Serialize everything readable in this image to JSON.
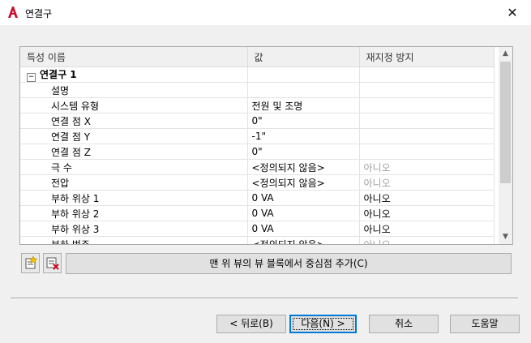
{
  "window": {
    "title": "연결구",
    "close_glyph": "✕"
  },
  "grid": {
    "columns": [
      "특성 이름",
      "값",
      "재지정 방지"
    ],
    "group": {
      "toggle": "−",
      "label": "연결구 1"
    },
    "rows": [
      {
        "name": "설명",
        "value": "",
        "no_override": "",
        "dim": false
      },
      {
        "name": "시스템 유형",
        "value": "전원 및 조명",
        "no_override": "",
        "dim": false
      },
      {
        "name": "연결 점 X",
        "value": "0\"",
        "no_override": "",
        "dim": false
      },
      {
        "name": "연결 점 Y",
        "value": "-1\"",
        "no_override": "",
        "dim": false
      },
      {
        "name": "연결 점 Z",
        "value": "0\"",
        "no_override": "",
        "dim": false
      },
      {
        "name": "극 수",
        "value": "<정의되지 않음>",
        "no_override": "아니오",
        "dim": true
      },
      {
        "name": "전압",
        "value": "<정의되지 않음>",
        "no_override": "아니오",
        "dim": true
      },
      {
        "name": "부하 위상 1",
        "value": "0 VA",
        "no_override": "아니오",
        "dim": false
      },
      {
        "name": "부하 위상 2",
        "value": "0 VA",
        "no_override": "아니오",
        "dim": false
      },
      {
        "name": "부하 위상 3",
        "value": "0 VA",
        "no_override": "아니오",
        "dim": false
      },
      {
        "name": "부하 범주",
        "value": "<정의되지 않음>",
        "no_override": "아니오",
        "dim": true
      }
    ]
  },
  "toolbar": {
    "center_button_label": "맨 위 뷰의 뷰 블록에서 중심점 추가(C)"
  },
  "buttons": {
    "back": "< 뒤로(B)",
    "next": "다음(N) >",
    "cancel": "취소",
    "help": "도움말"
  },
  "colors": {
    "app_icon": "#c8102e",
    "focus": "#0078d7"
  },
  "icons": {
    "app": "autocad-logo-icon",
    "add_property": "add-property-icon",
    "delete_property": "delete-property-icon"
  }
}
